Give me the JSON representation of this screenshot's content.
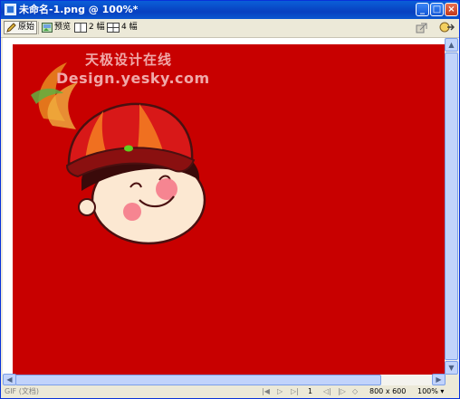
{
  "window": {
    "title": "未命名-1.png @ 100%*"
  },
  "titlebar_buttons": {
    "minimize": "_",
    "maximize": "□",
    "close": "×"
  },
  "toolbar": {
    "original_label": "原始",
    "preview_label": "预览",
    "two_up_label": "2 幅",
    "four_up_label": "4 幅"
  },
  "watermark": {
    "chinese": "天极设计在线",
    "english": "Design.yesky.com"
  },
  "status": {
    "format": "GIF (文档)",
    "frame": "1",
    "size": "800 x 600",
    "zoom": "100%"
  },
  "colors": {
    "canvas_bg": "#c80000",
    "titlebar": "#0a5fd8"
  }
}
